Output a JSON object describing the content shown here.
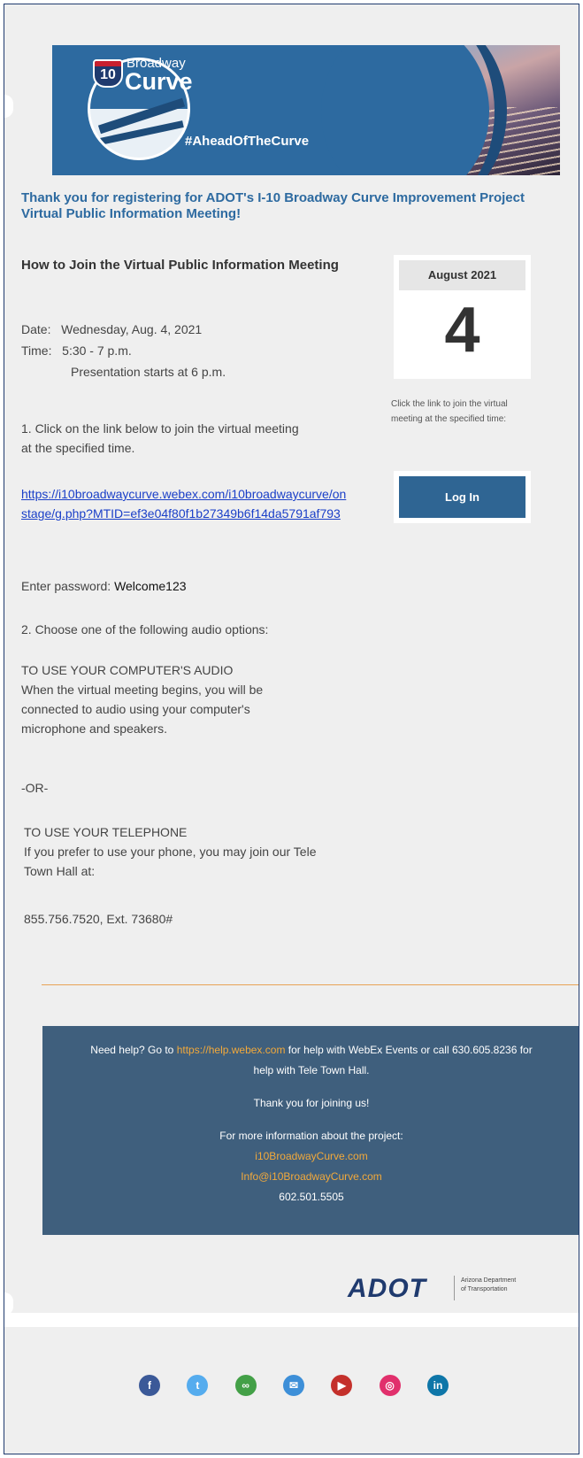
{
  "banner": {
    "brand_small": "Broadway",
    "brand_big": "Curve",
    "shield_number": "10",
    "hashtag": "#AheadOfTheCurve"
  },
  "heading": "Thank you for registering for ADOT's I-10 Broadway Curve Improvement Project Virtual Public Information Meeting!",
  "main": {
    "subhead": "How to Join the Virtual Public Information Meeting",
    "date_label": "Date:",
    "date_value": "Wednesday, Aug. 4, 2021",
    "time_label": "Time:",
    "time_value": "5:30 - 7 p.m.",
    "presentation": "Presentation starts at 6 p.m.",
    "step1": "1. Click on the link below to join the virtual meeting at the specified time.",
    "link": "https://i10broadwaycurve.webex.com/i10broadwaycurve/onstage/g.php?MTID=ef3e04f80f1b27349b6f14da5791af793",
    "password_label": "Enter password:",
    "password_value": "Welcome123",
    "step2": "2. Choose one of the following audio options:",
    "computer_heading": "TO USE YOUR COMPUTER'S AUDIO",
    "computer_text": "When the virtual meeting begins, you will be connected to audio using your computer's microphone and speakers.",
    "or": "-OR-",
    "phone_heading": "TO USE YOUR TELEPHONE",
    "phone_text": "If you prefer to use your phone, you may join our Tele Town Hall at:",
    "phone_number": "855.756.7520, Ext. 73680#"
  },
  "calendar": {
    "month": "August 2021",
    "day": "4"
  },
  "side_note": "Click the link to join the virtual meeting at the specified time:",
  "login_label": "Log In",
  "footer": {
    "help_pre": "Need help? Go to",
    "help_link": "https://help.webex.com",
    "help_post": "for help with WebEx Events or call 630.605.8236 for help with Tele Town Hall.",
    "thanks": "Thank you for joining us!",
    "more_info": "For more information about the project:",
    "website": "i10BroadwayCurve.com",
    "email": "Info@i10BroadwayCurve.com",
    "phone": "602.501.5505"
  },
  "adot": {
    "logo": "ADOT",
    "sub_line1": "Arizona Department",
    "sub_line2": "of Transportation"
  },
  "social": [
    {
      "name": "facebook-icon",
      "glyph": "f",
      "color": "#3b5998"
    },
    {
      "name": "twitter-icon",
      "glyph": "t",
      "color": "#55acee"
    },
    {
      "name": "link-icon",
      "glyph": "∞",
      "color": "#43a047"
    },
    {
      "name": "email-icon",
      "glyph": "✉",
      "color": "#3d8fd8"
    },
    {
      "name": "youtube-icon",
      "glyph": "▶",
      "color": "#c4302b"
    },
    {
      "name": "instagram-icon",
      "glyph": "◎",
      "color": "#e1306c"
    },
    {
      "name": "linkedin-icon",
      "glyph": "in",
      "color": "#0e76a8"
    }
  ]
}
